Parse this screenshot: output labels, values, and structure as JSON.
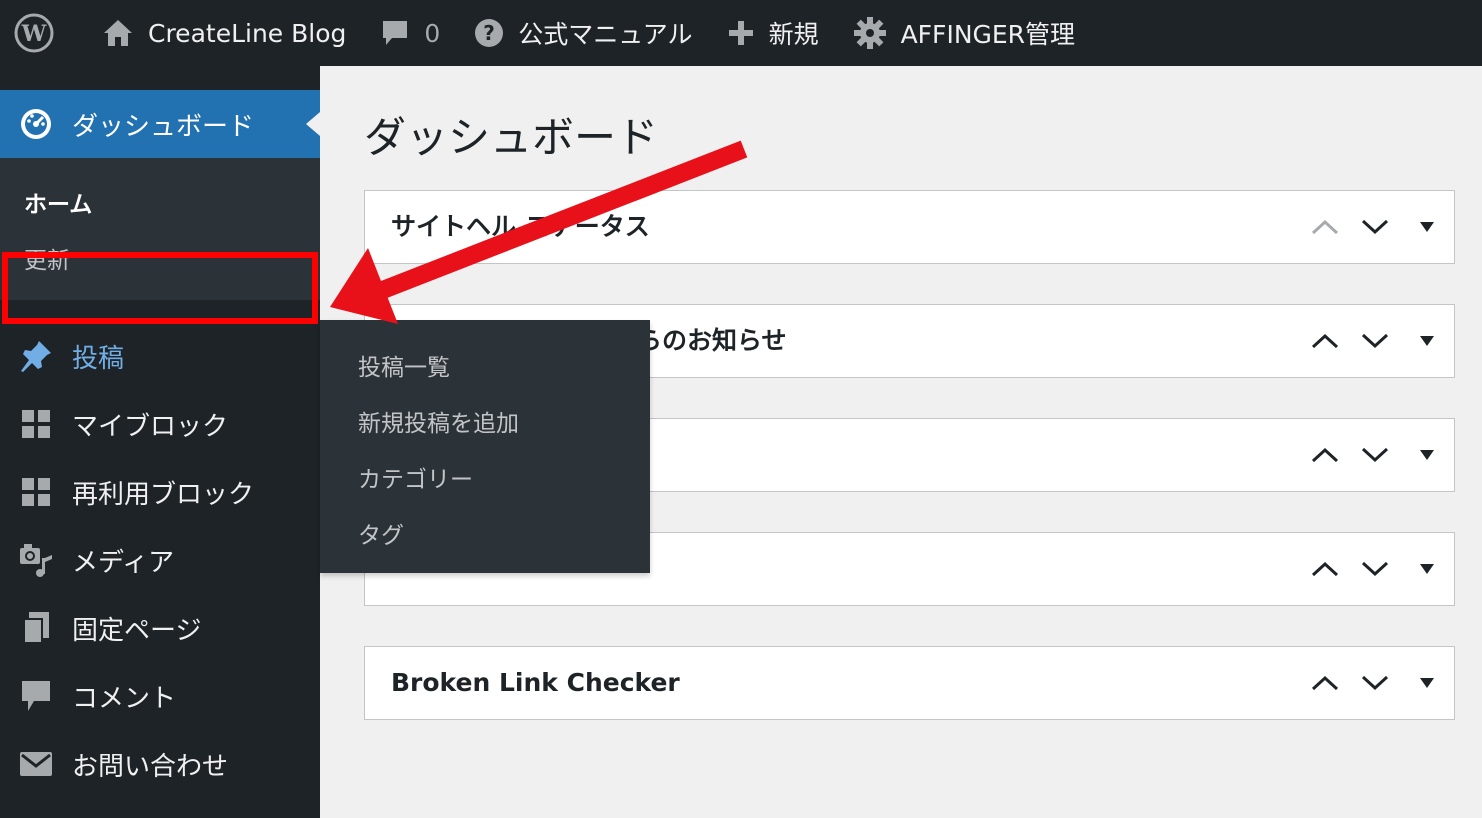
{
  "adminbar": {
    "site_name": "CreateLine Blog",
    "comments_count": "0",
    "manual_label": "公式マニュアル",
    "new_label": "新規",
    "affinger_label": "AFFINGER管理"
  },
  "sidebar": {
    "dashboard_label": "ダッシュボード",
    "submenu": [
      "ホーム",
      "更新"
    ],
    "items": [
      {
        "label": "投稿",
        "icon": "pin-icon"
      },
      {
        "label": "マイブロック",
        "icon": "blocks-icon"
      },
      {
        "label": "再利用ブロック",
        "icon": "blocks-icon"
      },
      {
        "label": "メディア",
        "icon": "media-icon"
      },
      {
        "label": "固定ページ",
        "icon": "pages-icon"
      },
      {
        "label": "コメント",
        "icon": "comment-icon"
      },
      {
        "label": "お問い合わせ",
        "icon": "mail-icon"
      }
    ]
  },
  "flyout": {
    "items": [
      "投稿一覧",
      "新規投稿を追加",
      "カテゴリー",
      "タグ"
    ]
  },
  "main": {
    "title": "ダッシュボード",
    "widgets": [
      "サイトヘル ステータス",
      "らのお知らせ",
      "",
      "",
      "Broken Link Checker"
    ]
  },
  "colors": {
    "adminbar_bg": "#1d2327",
    "active_menu": "#2271b1",
    "highlight": "#ff0000",
    "arrow": "#e8111a"
  }
}
